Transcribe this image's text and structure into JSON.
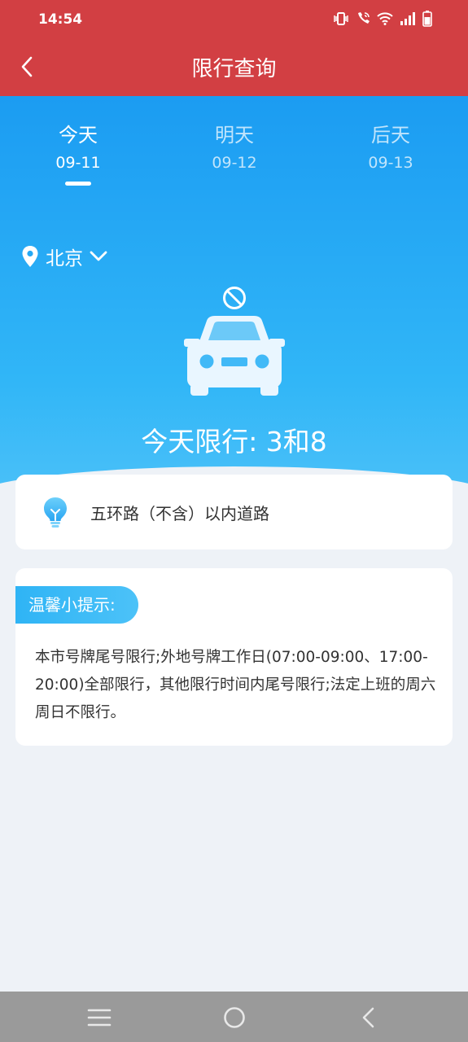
{
  "status_bar": {
    "time": "14:54",
    "icons": [
      "vibrate-icon",
      "wifi-call-icon",
      "wifi-icon",
      "signal-icon",
      "battery-icon"
    ]
  },
  "header": {
    "title": "限行查询",
    "back_icon": "chevron-left-icon"
  },
  "tabs": [
    {
      "name": "今天",
      "date": "09-11",
      "active": true
    },
    {
      "name": "明天",
      "date": "09-12",
      "active": false
    },
    {
      "name": "后天",
      "date": "09-13",
      "active": false
    }
  ],
  "city": {
    "name": "北京",
    "icon": "location-pin-icon",
    "dropdown_icon": "chevron-down-icon"
  },
  "hero": {
    "limit_text": "今天限行: 3和8"
  },
  "road_card": {
    "icon": "lightbulb-icon",
    "text": "五环路（不含）以内道路"
  },
  "tip_card": {
    "badge": "温馨小提示:",
    "text": "本市号牌尾号限行;外地号牌工作日(07:00-09:00、17:00-20:00)全部限行，其他限行时间内尾号限行;法定上班的周六周日不限行。"
  },
  "colors": {
    "header_red": "#d23f43",
    "hero_blue_top": "#1b9cf2",
    "hero_blue_bottom": "#4cc1f8",
    "background": "#eef2f7",
    "navbar": "#9a9a9a"
  },
  "navbar": {
    "icons": [
      "menu-icon",
      "home-circle-icon",
      "back-triangle-icon"
    ]
  }
}
